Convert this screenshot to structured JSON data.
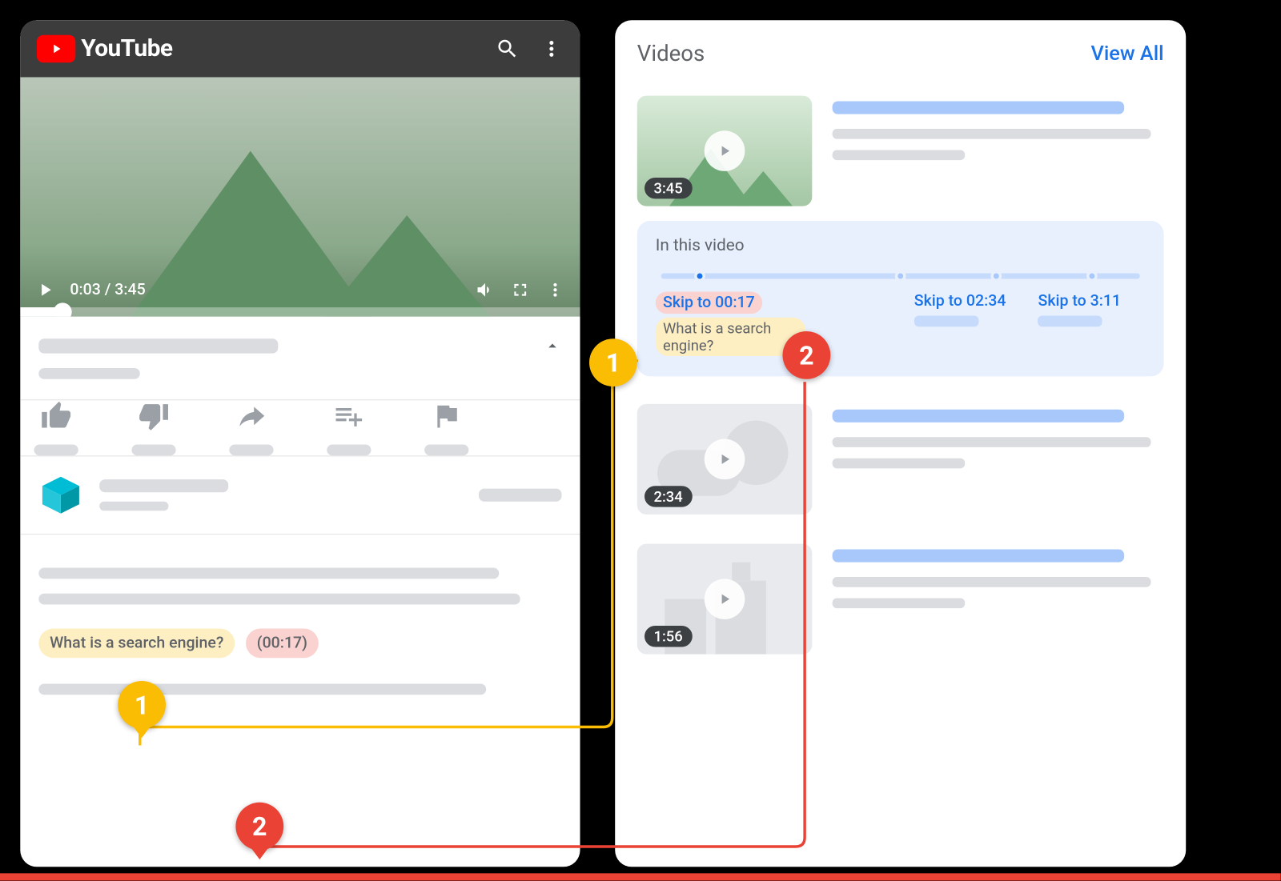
{
  "left": {
    "header": {
      "brand": "YouTube"
    },
    "player": {
      "current": "0:03",
      "total": "3:45",
      "time_display": "0:03 / 3:45"
    },
    "chip": {
      "title": "What is a search engine?",
      "time": "(00:17)"
    }
  },
  "right": {
    "heading": "Videos",
    "view_all": "View All",
    "results": [
      {
        "duration": "3:45"
      },
      {
        "duration": "2:34"
      },
      {
        "duration": "1:56"
      }
    ],
    "key_moments": {
      "title": "In this video",
      "items": [
        {
          "skip": "Skip to 00:17",
          "label": "What is a search engine?"
        },
        {
          "skip": "Skip to 02:34"
        },
        {
          "skip": "Skip to 3:11"
        }
      ]
    }
  },
  "callouts": {
    "one": "1",
    "two": "2"
  }
}
